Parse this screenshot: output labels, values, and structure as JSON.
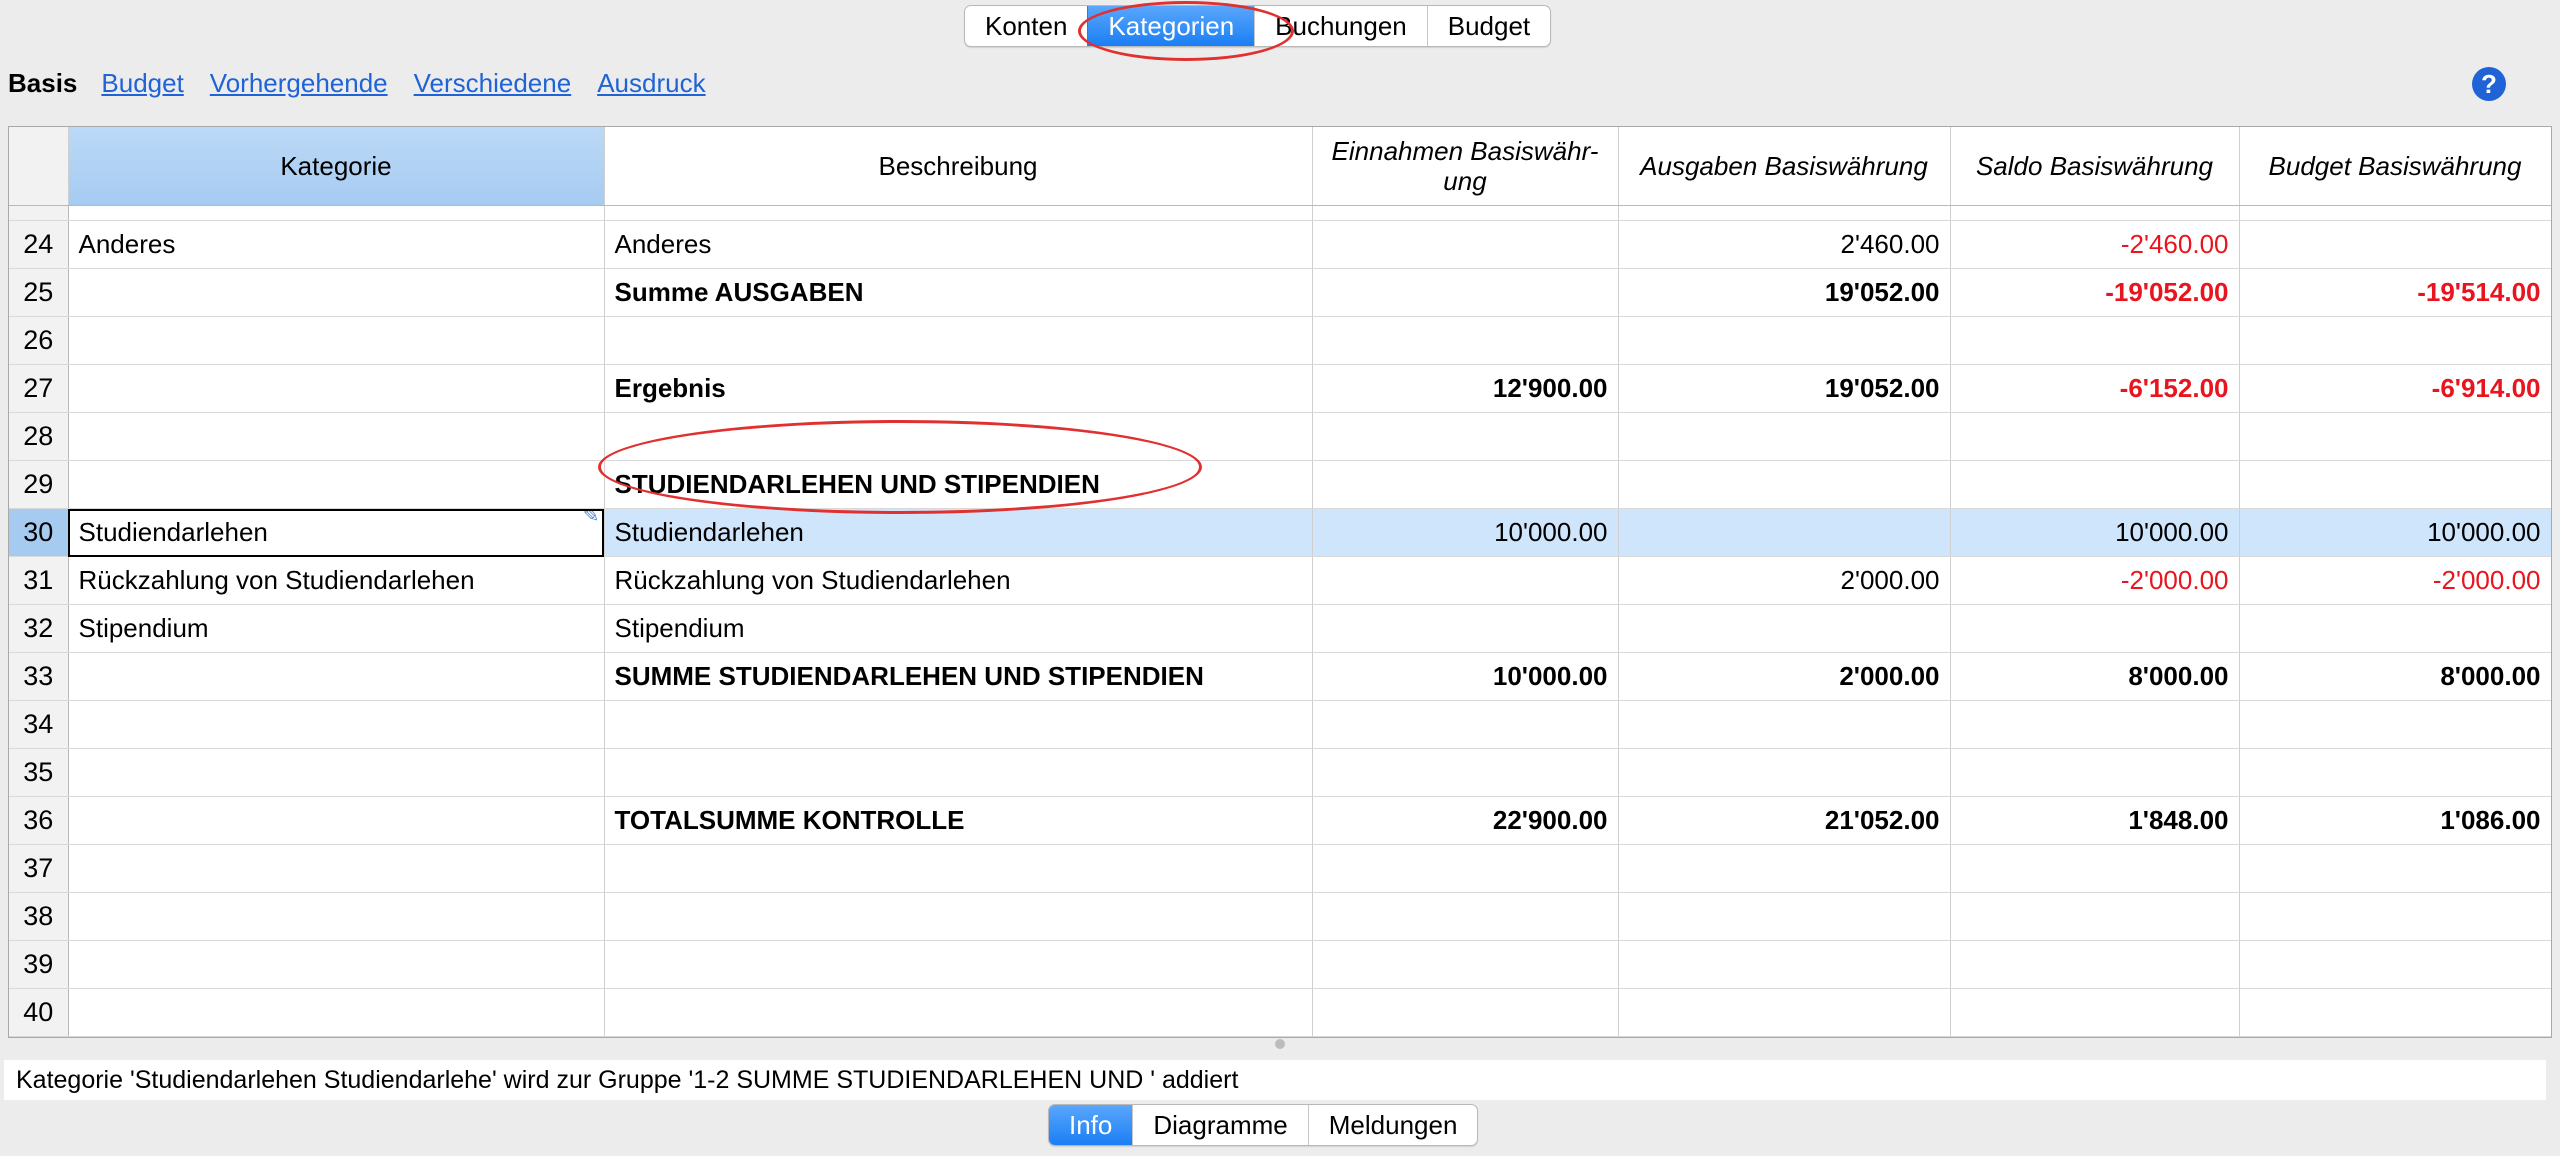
{
  "tabs_top": [
    "Konten",
    "Kategorien",
    "Buchungen",
    "Budget"
  ],
  "views": [
    "Basis",
    "Budget",
    "Vorhergehende",
    "Verschiedene",
    "Ausdruck"
  ],
  "help_label": "?",
  "columns": [
    "Kategorie",
    "Beschreibung",
    "Einnahmen Basiswähr-\nung",
    "Ausgaben Basiswährung",
    "Saldo Basiswährung",
    "Budget Basiswährung"
  ],
  "rows": [
    {
      "n": "24",
      "kat": "Anderes",
      "desc": "Anderes",
      "ein": "",
      "aus": "2'460.00",
      "saldo": "-2'460.00",
      "budget": ""
    },
    {
      "n": "25",
      "kat": "",
      "desc": "Summe AUSGABEN",
      "ein": "",
      "aus": "19'052.00",
      "saldo": "-19'052.00",
      "budget": "-19'514.00"
    },
    {
      "n": "26",
      "kat": "",
      "desc": "",
      "ein": "",
      "aus": "",
      "saldo": "",
      "budget": ""
    },
    {
      "n": "27",
      "kat": "",
      "desc": "Ergebnis",
      "ein": "12'900.00",
      "aus": "19'052.00",
      "saldo": "-6'152.00",
      "budget": "-6'914.00"
    },
    {
      "n": "28",
      "kat": "",
      "desc": "",
      "ein": "",
      "aus": "",
      "saldo": "",
      "budget": ""
    },
    {
      "n": "29",
      "kat": "",
      "desc": "STUDIENDARLEHEN UND STIPENDIEN",
      "ein": "",
      "aus": "",
      "saldo": "",
      "budget": ""
    },
    {
      "n": "30",
      "kat": "Studiendarlehen",
      "desc": "Studiendarlehen",
      "ein": "10'000.00",
      "aus": "",
      "saldo": "10'000.00",
      "budget": "10'000.00"
    },
    {
      "n": "31",
      "kat": "Rückzahlung von Studiendarlehen",
      "desc": "Rückzahlung von Studiendarlehen",
      "ein": "",
      "aus": "2'000.00",
      "saldo": "-2'000.00",
      "budget": "-2'000.00"
    },
    {
      "n": "32",
      "kat": "Stipendium",
      "desc": "Stipendium",
      "ein": "",
      "aus": "",
      "saldo": "",
      "budget": ""
    },
    {
      "n": "33",
      "kat": "",
      "desc": "SUMME STUDIENDARLEHEN UND STIPENDIEN",
      "ein": "10'000.00",
      "aus": "2'000.00",
      "saldo": "8'000.00",
      "budget": "8'000.00"
    },
    {
      "n": "34",
      "kat": "",
      "desc": "",
      "ein": "",
      "aus": "",
      "saldo": "",
      "budget": ""
    },
    {
      "n": "35",
      "kat": "",
      "desc": "",
      "ein": "",
      "aus": "",
      "saldo": "",
      "budget": ""
    },
    {
      "n": "36",
      "kat": "",
      "desc": "TOTALSUMME KONTROLLE",
      "ein": "22'900.00",
      "aus": "21'052.00",
      "saldo": "1'848.00",
      "budget": "1'086.00"
    },
    {
      "n": "37",
      "kat": "",
      "desc": "",
      "ein": "",
      "aus": "",
      "saldo": "",
      "budget": ""
    },
    {
      "n": "38",
      "kat": "",
      "desc": "",
      "ein": "",
      "aus": "",
      "saldo": "",
      "budget": ""
    },
    {
      "n": "39",
      "kat": "",
      "desc": "",
      "ein": "",
      "aus": "",
      "saldo": "",
      "budget": ""
    },
    {
      "n": "40",
      "kat": "",
      "desc": "",
      "ein": "",
      "aus": "",
      "saldo": "",
      "budget": ""
    }
  ],
  "info_text": "Kategorie 'Studiendarlehen Studiendarlehe' wird zur Gruppe '1-2 SUMME STUDIENDARLEHEN UND ' addiert",
  "tabs_bottom": [
    "Info",
    "Diagramme",
    "Meldungen"
  ],
  "colors": {
    "accent": "#1a7ef5",
    "negative": "#e8141e",
    "selection": "#cfe5fb",
    "annotation": "#e0302f"
  }
}
